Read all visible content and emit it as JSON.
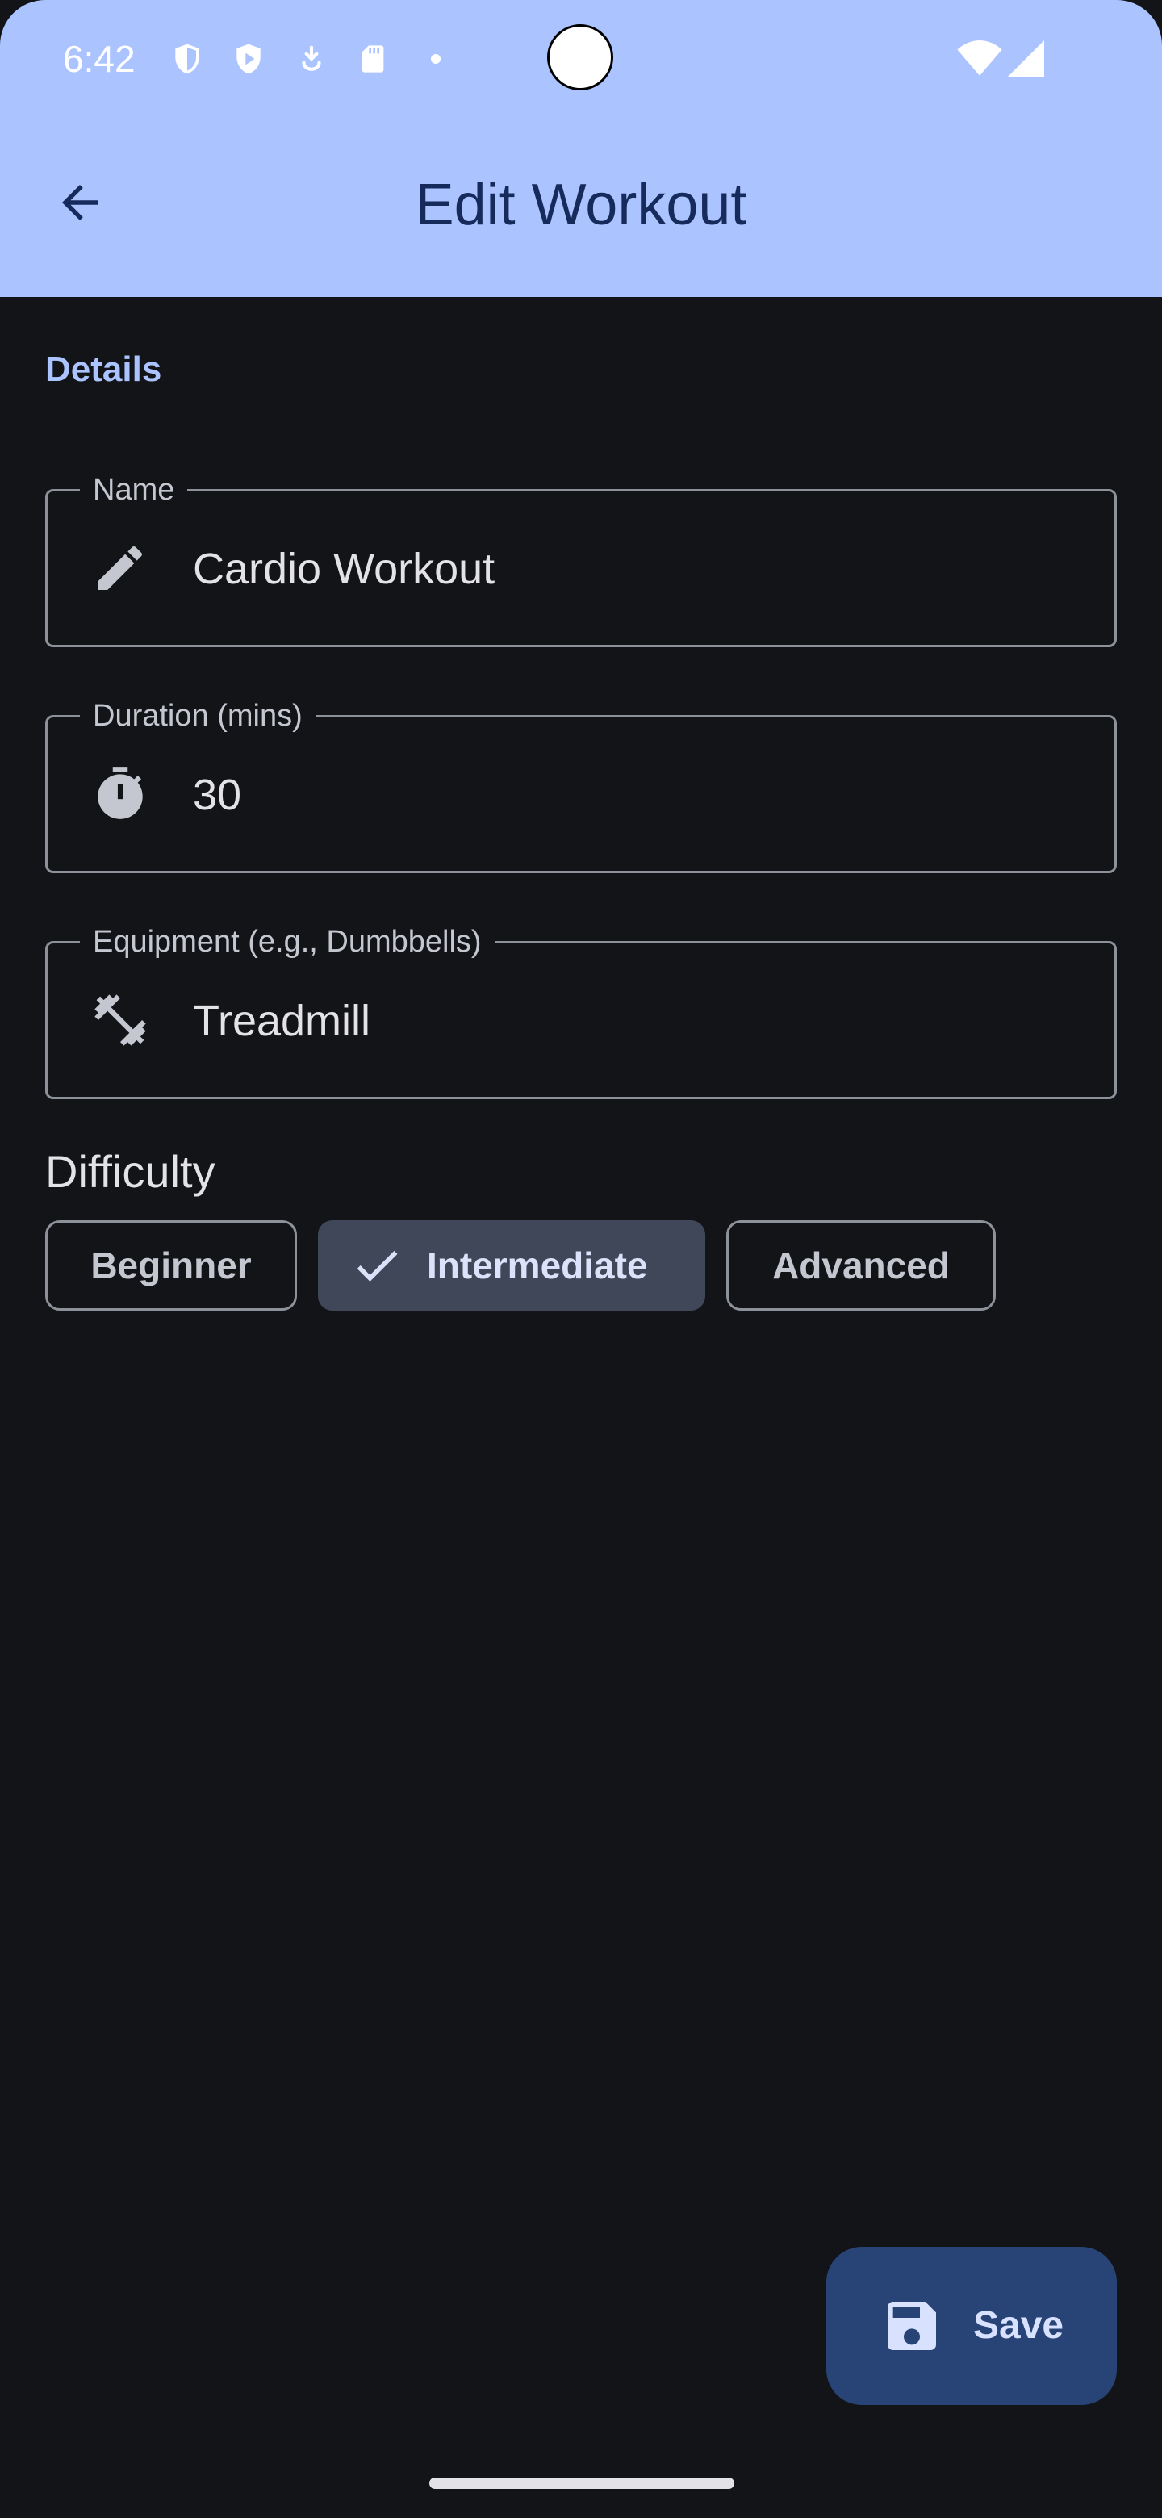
{
  "status_bar": {
    "time": "6:42",
    "icons": [
      "vpn-shield-icon",
      "play-protect-icon",
      "download-icon",
      "sd-card-icon",
      "dot-icon",
      "wifi-icon",
      "signal-icon"
    ]
  },
  "app_bar": {
    "title": "Edit Workout",
    "back_icon": "arrow-back-icon"
  },
  "form": {
    "section_label": "Details",
    "name": {
      "label": "Name",
      "value": "Cardio Workout",
      "icon": "pencil-icon"
    },
    "duration": {
      "label": "Duration (mins)",
      "value": "30",
      "icon": "stopwatch-icon"
    },
    "equipment": {
      "label": "Equipment (e.g., Dumbbells)",
      "value": "Treadmill",
      "icon": "dumbbell-icon"
    },
    "difficulty": {
      "title": "Difficulty",
      "options": [
        "Beginner",
        "Intermediate",
        "Advanced"
      ],
      "selected": "Intermediate"
    }
  },
  "fab": {
    "label": "Save",
    "icon": "save-icon"
  },
  "colors": {
    "header_bg": "#abc4ff",
    "title_text": "#162b5c",
    "background": "#131418",
    "accent_label": "#abc4ff",
    "selected_chip_bg": "#3f4759",
    "fab_bg": "#284477"
  }
}
